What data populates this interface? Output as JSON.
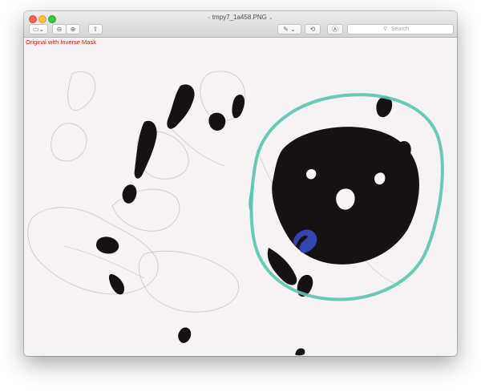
{
  "window": {
    "title": "tmpy7_1a458.PNG",
    "title_chevron": "⌄"
  },
  "toolbar": {
    "sidebar_icon": "▭",
    "sidebar_chevron": "⌄",
    "zoom_out_icon": "⊖",
    "zoom_in_icon": "⊕",
    "share_icon": "⇧",
    "markup_icon": "✎ ⌄",
    "rotate_icon": "⟲",
    "annotate_icon": "Ⓐ",
    "search_icon": "⚲",
    "search_placeholder": "Search"
  },
  "image": {
    "overlay_label": "Original with Inverse Mask",
    "label_color": "#e01010",
    "mask_ring_color": "#5ec4b0",
    "blue_mark_color": "#3a4fc8",
    "tissue_color": "#161214"
  }
}
